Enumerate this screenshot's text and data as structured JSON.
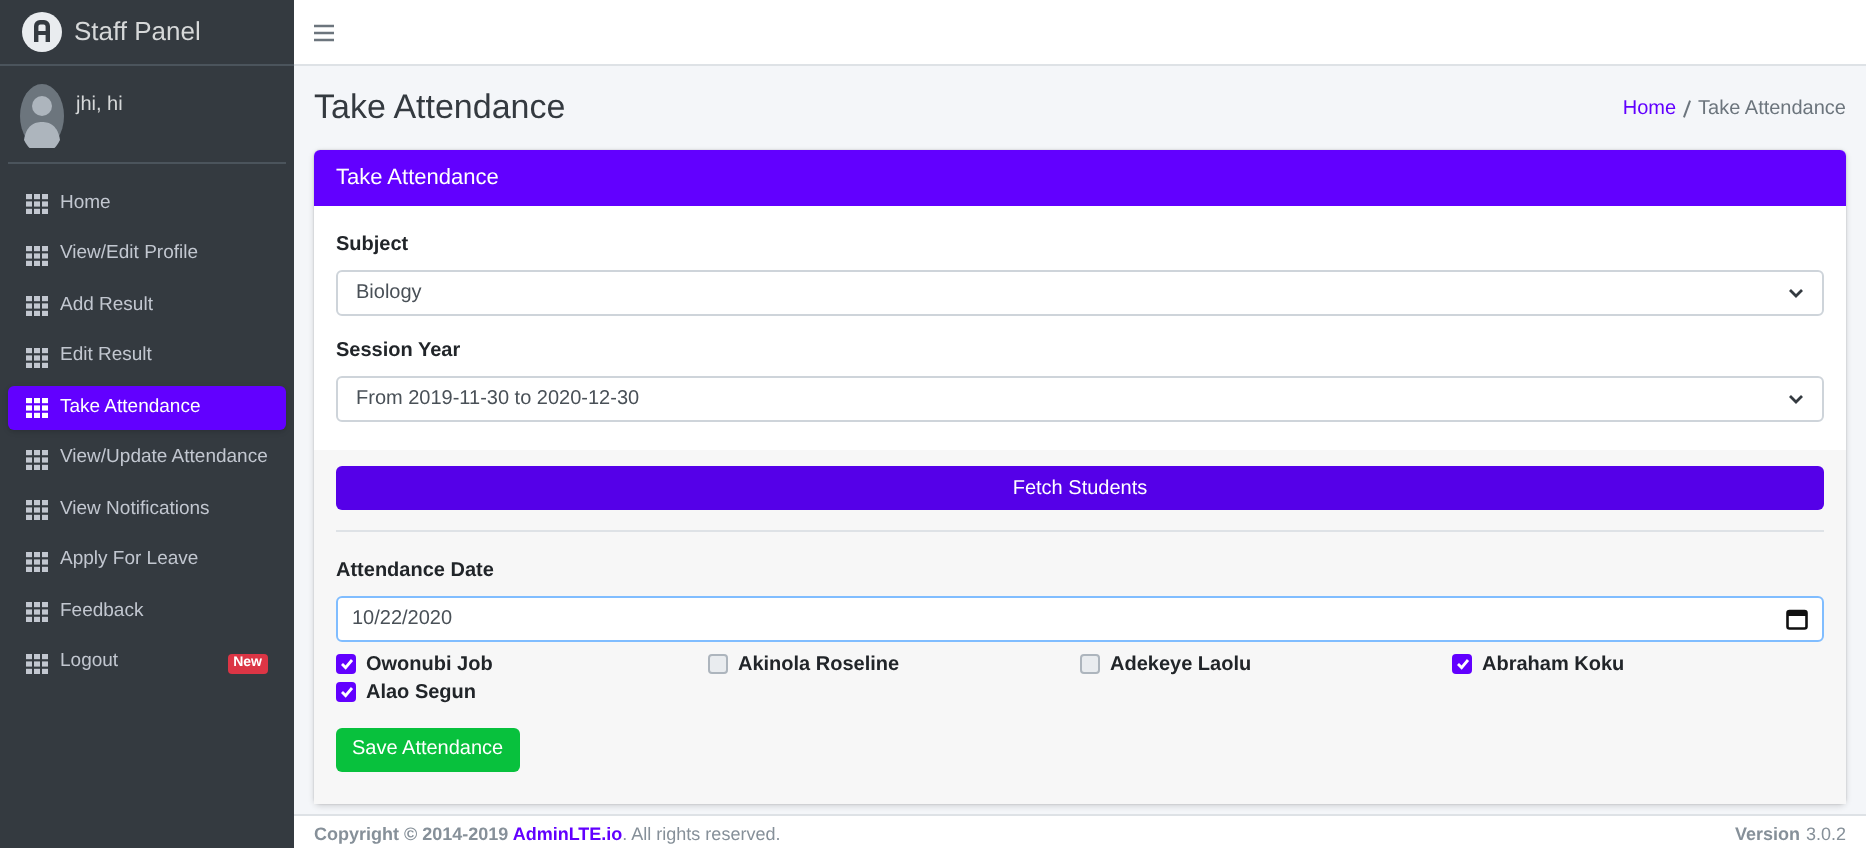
{
  "sidebar": {
    "brand": "Staff Panel",
    "user": "jhi, hi",
    "items": [
      {
        "label": "Home",
        "selected": false
      },
      {
        "label": "View/Edit Profile",
        "selected": false
      },
      {
        "label": "Add Result",
        "selected": false
      },
      {
        "label": "Edit Result",
        "selected": false
      },
      {
        "label": "Take Attendance",
        "selected": true
      },
      {
        "label": "View/Update Attendance",
        "selected": false
      },
      {
        "label": "View Notifications",
        "selected": false
      },
      {
        "label": "Apply For Leave",
        "selected": false
      },
      {
        "label": "Feedback",
        "selected": false
      },
      {
        "label": "Logout",
        "selected": false,
        "badge": "New"
      }
    ]
  },
  "page_title": "Take Attendance",
  "breadcrumb": [
    {
      "label": "Home",
      "kind": "link"
    },
    {
      "label": "Take Attendance",
      "kind": "current"
    }
  ],
  "card": {
    "title": "Take Attendance",
    "fields": [
      {
        "label": "Subject",
        "value": "Biology"
      },
      {
        "label": "Session Year",
        "value": "From 2019-11-30 to 2020-12-30"
      }
    ],
    "fetch_button": "Fetch Students",
    "date_label": "Attendance Date",
    "date_value": "10/22/2020",
    "students": [
      {
        "name": "Owonubi Job",
        "checked": true
      },
      {
        "name": "Akinola Roseline",
        "checked": false
      },
      {
        "name": "Adekeye Laolu",
        "checked": false
      },
      {
        "name": "Abraham Koku",
        "checked": true
      },
      {
        "name": "Alao Segun",
        "checked": true
      }
    ],
    "save_button": "Save Attendance"
  },
  "footer": {
    "copyright": "Copyright © 2014-2019 ",
    "link": "AdminLTE.io",
    "rights": ". All rights reserved.",
    "version_label": "Version",
    "version": "3.0.2"
  }
}
